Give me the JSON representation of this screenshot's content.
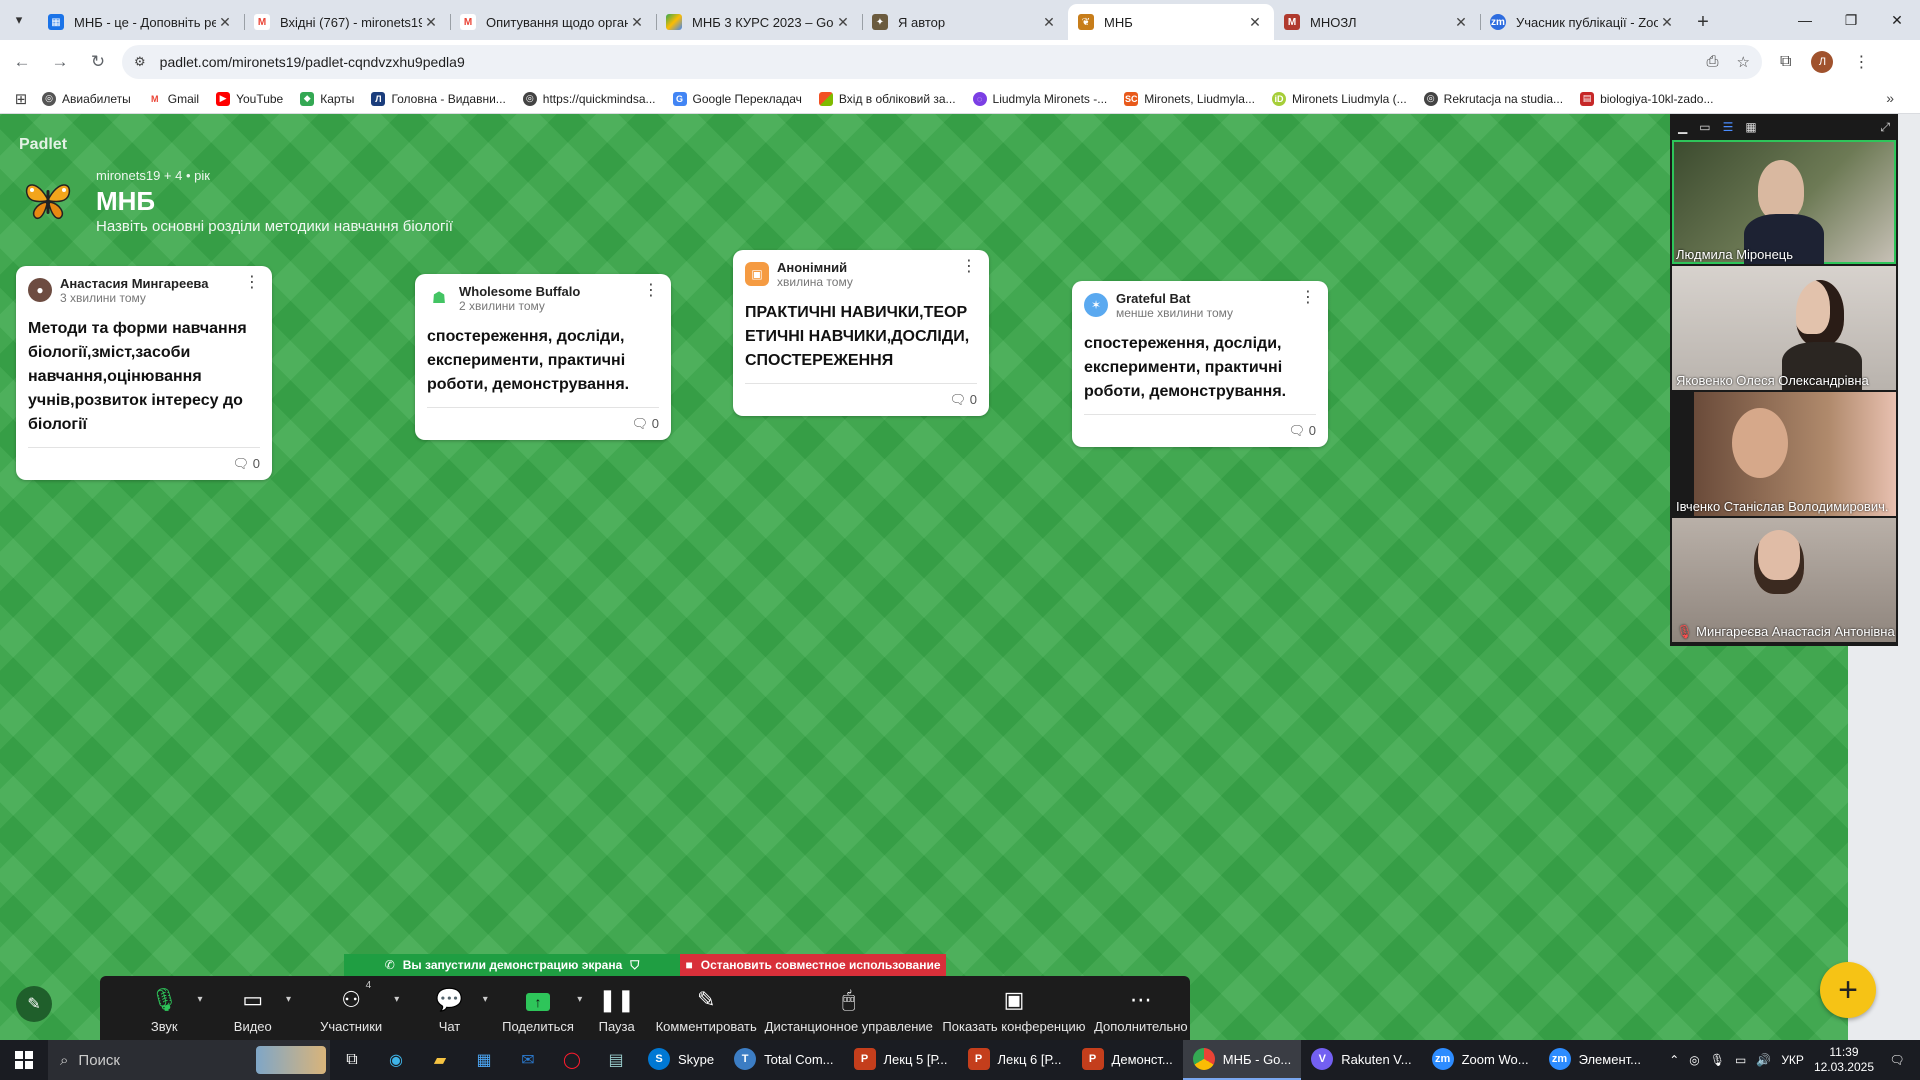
{
  "browser": {
    "tabs": [
      {
        "title": "МНБ - це - Доповніть ре",
        "favicon_color": "#1a73e8",
        "icon": "padlet-grid-icon"
      },
      {
        "title": "Вхідні (767) - mironets19@",
        "favicon_color": "#ea4335",
        "icon": "gmail-icon"
      },
      {
        "title": "Опитування щодо орган",
        "favicon_color": "#ea4335",
        "icon": "gmail-icon"
      },
      {
        "title": "МНБ 3 КУРС 2023 – Goog",
        "favicon_color": "#34a853",
        "icon": "drive-icon"
      },
      {
        "title": "Я автор",
        "favicon_color": "#6b5b3e",
        "icon": "author-icon"
      },
      {
        "title": "МНБ",
        "favicon_color": "#c77d1a",
        "icon": "butterfly-icon",
        "active": true
      },
      {
        "title": "МНОЗЛ",
        "favicon_color": "#b03a2e",
        "icon": "mnozl-icon"
      },
      {
        "title": "Учасник публікації - Zoo",
        "favicon_color": "#2d6cdf",
        "icon": "zoom-icon"
      }
    ],
    "url": "padlet.com/mironets19/padlet-cqndvzxhu9pedla9",
    "profile_initial": "Л",
    "bookmarks": [
      {
        "label": "Авиабилеты",
        "color": "#555555"
      },
      {
        "label": "Gmail",
        "color": "#ea4335"
      },
      {
        "label": "YouTube",
        "color": "#ff0000"
      },
      {
        "label": "Карты",
        "color": "#34a853"
      },
      {
        "label": "Головна - Видавни...",
        "color": "#1a3d7c"
      },
      {
        "label": "https://quickmindsa...",
        "color": "#444444"
      },
      {
        "label": "Google Перекладач",
        "color": "#4285f4"
      },
      {
        "label": "Вхід в обліковий за...",
        "color": "#f4b400"
      },
      {
        "label": "Liudmyla Mironets -...",
        "color": "#7b3fe4"
      },
      {
        "label": "Mironets, Liudmyla...",
        "color": "#e8591a"
      },
      {
        "label": "Mironets Liudmyla (...",
        "color": "#a6ce39"
      },
      {
        "label": "Rekrutacja na studia...",
        "color": "#444444"
      },
      {
        "label": "biologiya-10kl-zado...",
        "color": "#c62828"
      }
    ]
  },
  "padlet": {
    "brand": "Padlet",
    "meta": "mironets19 + 4 • рік",
    "title": "МНБ",
    "description": "Назвіть основні розділи методики навчання біології",
    "cards": [
      {
        "author": "Анастасия Мингареева",
        "time": "3 хвилини тому",
        "body": "Методи та форми навчання біології,зміст,засоби навчання,оцінювання учнів,розвиток інтересу до біології",
        "comments": "0",
        "avatar_color": "#6d4c41"
      },
      {
        "author": "Wholesome Buffalo",
        "time": "2 хвилини тому",
        "body": "спостереження, досліди, експерименти, практичні роботи, демонстрування.",
        "comments": "0",
        "avatar_color": "#43c463"
      },
      {
        "author": "Анонімний",
        "time": "хвилина тому",
        "body": "ПРАКТИЧНІ НАВИЧКИ,ТЕОРЕТИЧНІ НАВЧИКИ,ДОСЛІДИ,СПОСТЕРЕЖЕННЯ",
        "comments": "0",
        "avatar_color": "#f59b42"
      },
      {
        "author": "Grateful Bat",
        "time": "менше хвилини тому",
        "body": "спостереження, досліди, експерименти, практичні роботи, демонстрування.",
        "comments": "0",
        "avatar_color": "#5aa9f0"
      }
    ]
  },
  "zoom": {
    "participants": [
      {
        "name": "Людмила Міронець",
        "bg": "#4b5a3c"
      },
      {
        "name": "Яковенко Олеся Олександрівна",
        "bg": "#c9c4c0"
      },
      {
        "name": "Івченко Станіслав Володимирович.",
        "bg": "#8a6a52"
      },
      {
        "name": "Мингареєва Анастасія Антонівна",
        "bg": "#a79a90"
      }
    ],
    "share_banner": "Вы запустили демонстрацию экрана",
    "stop_share": "Остановить совместное использование",
    "toolbar": {
      "audio": "Звук",
      "video": "Видео",
      "participants": "Участники",
      "participants_count": "4",
      "chat": "Чат",
      "share": "Поделиться",
      "pause": "Пауза",
      "annotate": "Комментировать",
      "remote": "Дистанционное управление",
      "view": "Показать конференцию",
      "more": "Дополнительно"
    }
  },
  "taskbar": {
    "search": "Поиск",
    "apps": [
      {
        "label": "Skype",
        "color": "#0078d4",
        "glyph": "S"
      },
      {
        "label": "Total Com...",
        "color": "#3c7dc4",
        "glyph": "T"
      },
      {
        "label": "Лекц 5 [Р...",
        "color": "#c43e1c",
        "glyph": "P"
      },
      {
        "label": "Лекц 6 [Р...",
        "color": "#c43e1c",
        "glyph": "P"
      },
      {
        "label": "Демонст...",
        "color": "#c43e1c",
        "glyph": "P"
      },
      {
        "label": "МНБ - Go...",
        "color": "#4285f4",
        "glyph": "G",
        "active": true
      },
      {
        "label": "Rakuten V...",
        "color": "#7360f2",
        "glyph": "V"
      },
      {
        "label": "Zoom Wo...",
        "color": "#2d8cff",
        "glyph": "zm"
      },
      {
        "label": "Элемент...",
        "color": "#2d8cff",
        "glyph": "zm"
      }
    ],
    "language": "УКР",
    "time": "11:39",
    "date": "12.03.2025"
  }
}
